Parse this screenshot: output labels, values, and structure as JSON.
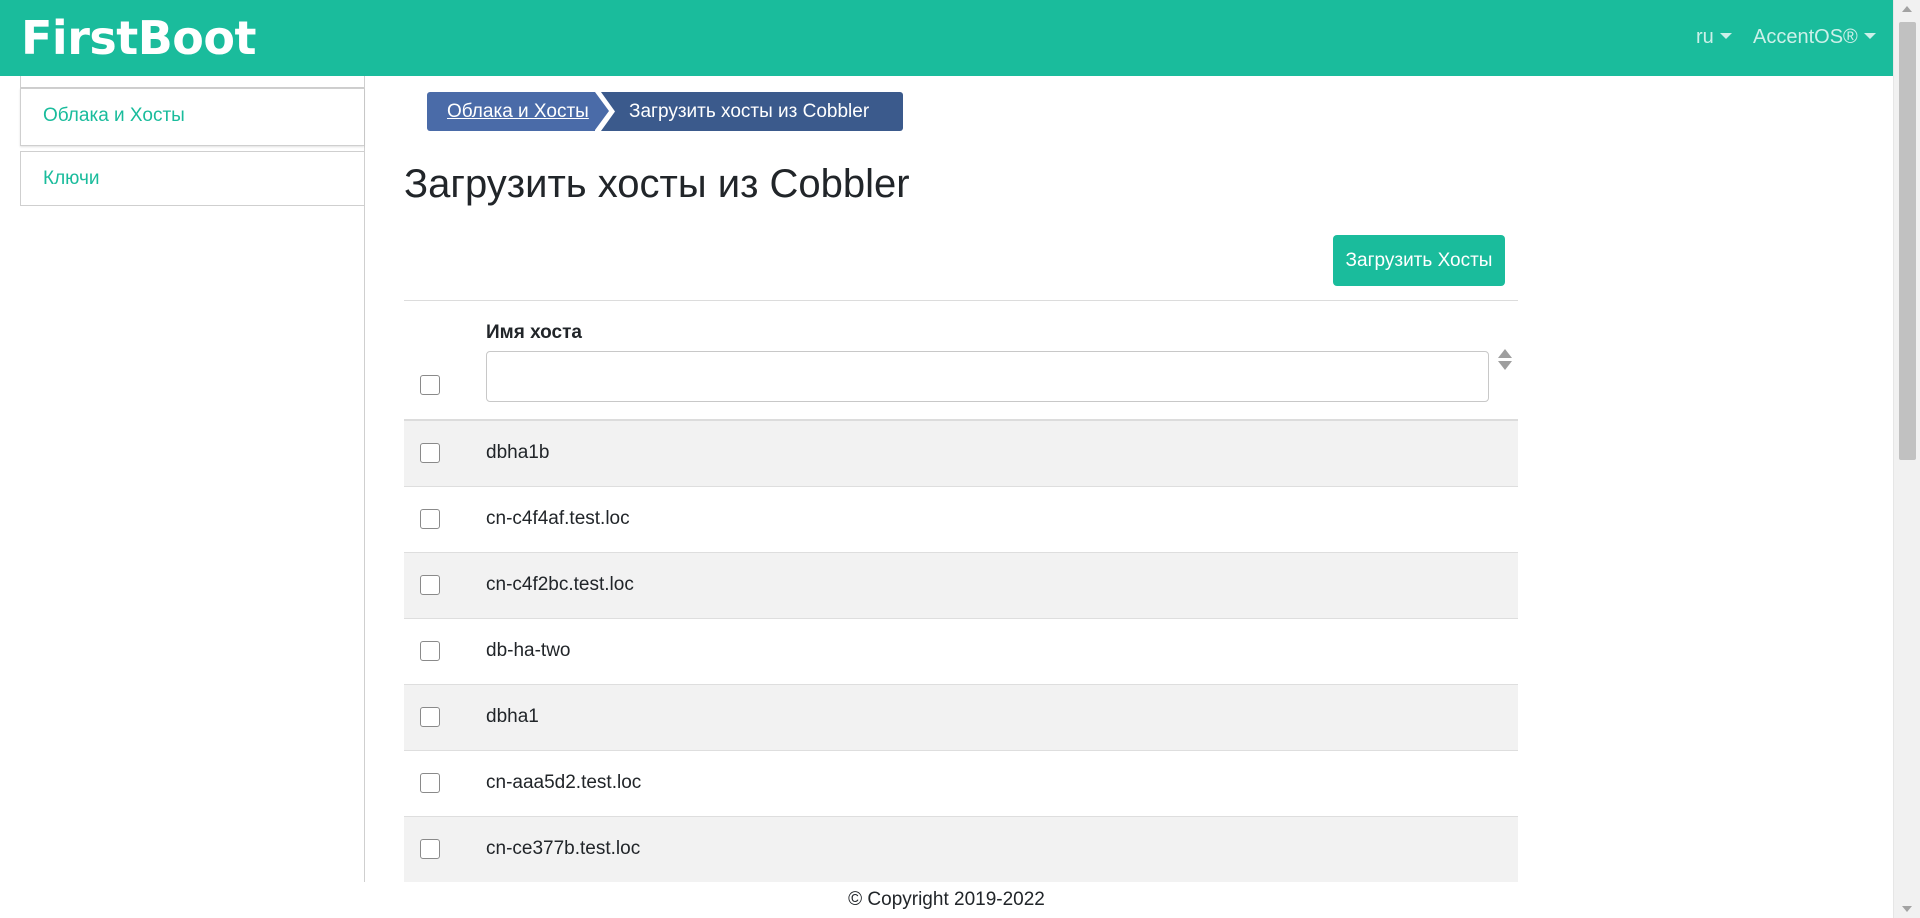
{
  "header": {
    "brand": "FirstBoot",
    "language": "ru",
    "user": "AccentOS®"
  },
  "sidebar": {
    "items": [
      {
        "label": "Облака и Хосты"
      },
      {
        "label": "Ключи"
      }
    ]
  },
  "breadcrumb": {
    "items": [
      "Облака и Хосты",
      "Загрузить хосты из Cobbler"
    ]
  },
  "page": {
    "title": "Загрузить хосты из Cobbler",
    "load_button": "Загрузить Хосты"
  },
  "table": {
    "column_header": "Имя хоста",
    "filter_value": "",
    "rows": [
      {
        "host": "dbha1b"
      },
      {
        "host": "cn-c4f4af.test.loc"
      },
      {
        "host": "cn-c4f2bc.test.loc"
      },
      {
        "host": "db-ha-two"
      },
      {
        "host": "dbha1"
      },
      {
        "host": "cn-aaa5d2.test.loc"
      },
      {
        "host": "cn-ce377b.test.loc"
      }
    ]
  },
  "footer": {
    "copyright": "© Copyright 2019-2022"
  },
  "colors": {
    "accent": "#1abc9c",
    "breadcrumb_primary": "#4a6ba8",
    "breadcrumb_active": "#3b5a8c",
    "row_stripe": "#f2f2f2"
  }
}
